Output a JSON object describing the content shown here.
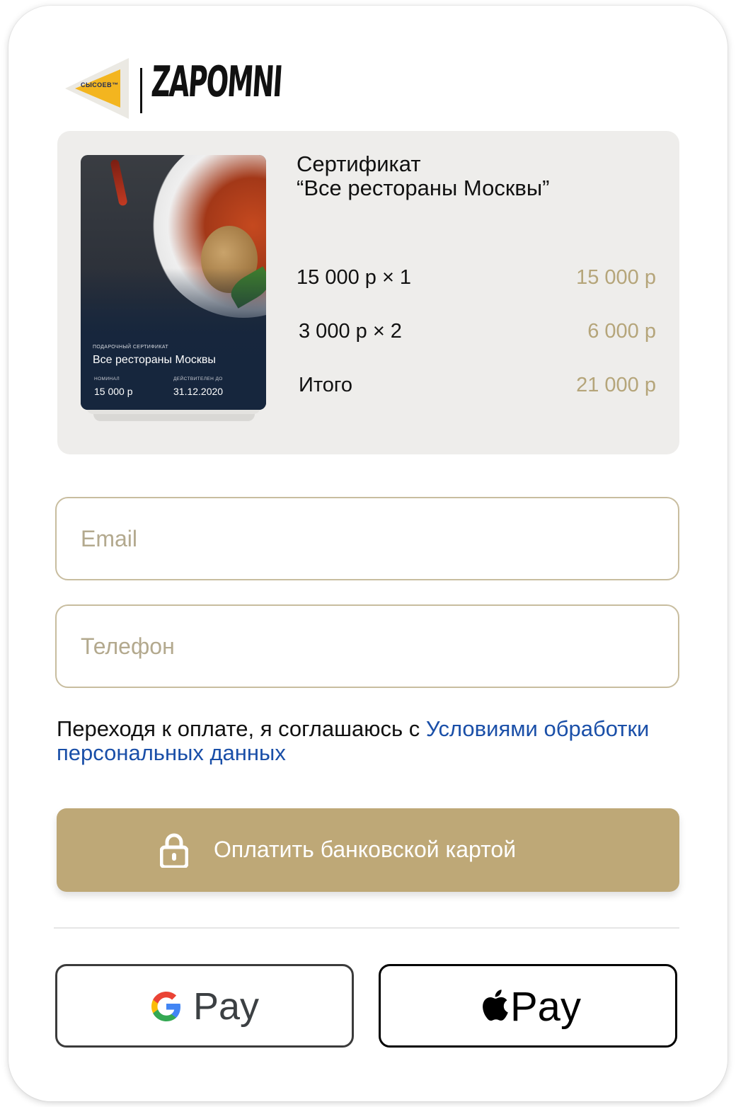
{
  "logo": {
    "brand_primary": "СЫСОЕВ™",
    "brand_secondary": "ZAPOMNI"
  },
  "order": {
    "title_line1": "Сертификат",
    "title_line2": "“Все рестораны Москвы”",
    "items": [
      {
        "qty_label": "15 000 р × 1",
        "sum": "15 000 р"
      },
      {
        "qty_label": "3 000 р × 2",
        "sum": "6 000 р"
      }
    ],
    "total_label": "Итого",
    "total_sum": "21 000 р"
  },
  "certificate": {
    "kicker": "ПОДАРОЧНЫЙ СЕРТИФИКАТ",
    "name": "Все рестораны Москвы",
    "nominal_label": "НОМИНАЛ",
    "nominal_value": "15 000 р",
    "valid_label": "ДЕЙСТВИТЕЛЕН ДО",
    "valid_value": "31.12.2020"
  },
  "form": {
    "email_placeholder": "Email",
    "phone_placeholder": "Телефон",
    "consent_text": "Переходя к оплате, я соглашаюсь с ",
    "consent_link": "Условиями обработки персональных данных"
  },
  "payment": {
    "card_button_label": "Оплатить банковской картой",
    "google_pay_label": "Pay",
    "apple_pay_label": "Pay"
  },
  "colors": {
    "accent": "#bea877",
    "price": "#b5a57a",
    "link": "#1a4fa8",
    "panel": "#eeedeb"
  }
}
